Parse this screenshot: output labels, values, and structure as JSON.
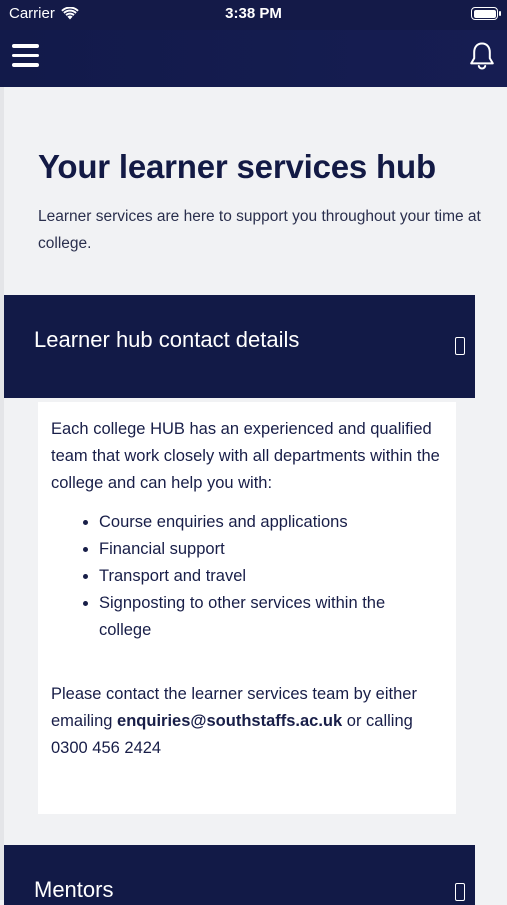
{
  "status_bar": {
    "carrier": "Carrier",
    "time": "3:38 PM",
    "battery_level": 1.0
  },
  "app_bar": {
    "menu_icon": "hamburger-menu-icon",
    "notifications_icon": "bell-icon",
    "background": "#131a48"
  },
  "page": {
    "title": "Your learner services hub",
    "intro": "Learner services are here to support you throughout your time at college."
  },
  "accordions": [
    {
      "title": "Learner hub contact details",
      "expanded": true,
      "icon": "expand-toggle-icon",
      "body": {
        "paragraph": "Each college HUB has an experienced and qualified team that work closely with all departments within the college and can help you with:",
        "list": [
          "Course enquiries and applications",
          "Financial support",
          "Transport and travel",
          "Signposting to other services within the college"
        ],
        "contact_prefix": "Please contact the learner services team by either emailing ",
        "email": "enquiries@southstaffs.ac.uk",
        "contact_suffix": " or calling 0300 456 2424"
      }
    },
    {
      "title": "Mentors",
      "expanded": false,
      "icon": "expand-toggle-icon"
    }
  ],
  "colors": {
    "navy": "#121a47",
    "page_bg": "#f1f2f4",
    "text": "#181e48"
  }
}
